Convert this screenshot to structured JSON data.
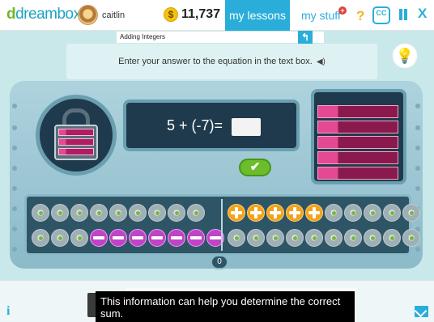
{
  "header": {
    "logo_first": "d",
    "logo_rest": "dreambox",
    "username": "caitlin",
    "coin_symbol": "$",
    "coins": "11,737",
    "tab_lessons": "my lessons",
    "tab_stuff": "my stuff",
    "stuff_badge": "+",
    "help": "?",
    "cc": "CC",
    "close": "X",
    "active_tab_color": "#2aaed9"
  },
  "lesson": {
    "title": "Adding Integers",
    "back_glyph": "↰",
    "instruction": "Enter your answer to the equation in the text box.",
    "speaker": "◀)",
    "hint_glyph": "💡"
  },
  "equation": {
    "expression": "5 + (-7)=",
    "answer_value": "",
    "check_glyph": "✔"
  },
  "tray": {
    "top_left": [
      "empty",
      "empty",
      "empty",
      "empty",
      "empty",
      "empty",
      "empty",
      "empty",
      "empty"
    ],
    "top_right": [
      "pos",
      "pos",
      "pos",
      "pos",
      "pos",
      "empty",
      "empty",
      "empty",
      "empty",
      "empty"
    ],
    "bottom_left": [
      "empty",
      "empty",
      "empty",
      "neg",
      "neg",
      "neg",
      "neg",
      "neg",
      "neg",
      "neg"
    ],
    "bottom_right": [
      "empty",
      "empty",
      "empty",
      "empty",
      "empty",
      "empty",
      "empty",
      "empty",
      "empty",
      "empty"
    ],
    "total": "0"
  },
  "footer": {
    "info": "i",
    "caption": "This information can help you determine the correct sum."
  },
  "colors": {
    "positive": "#f3a31b",
    "negative": "#c043c9",
    "check": "#6cbd2b"
  }
}
